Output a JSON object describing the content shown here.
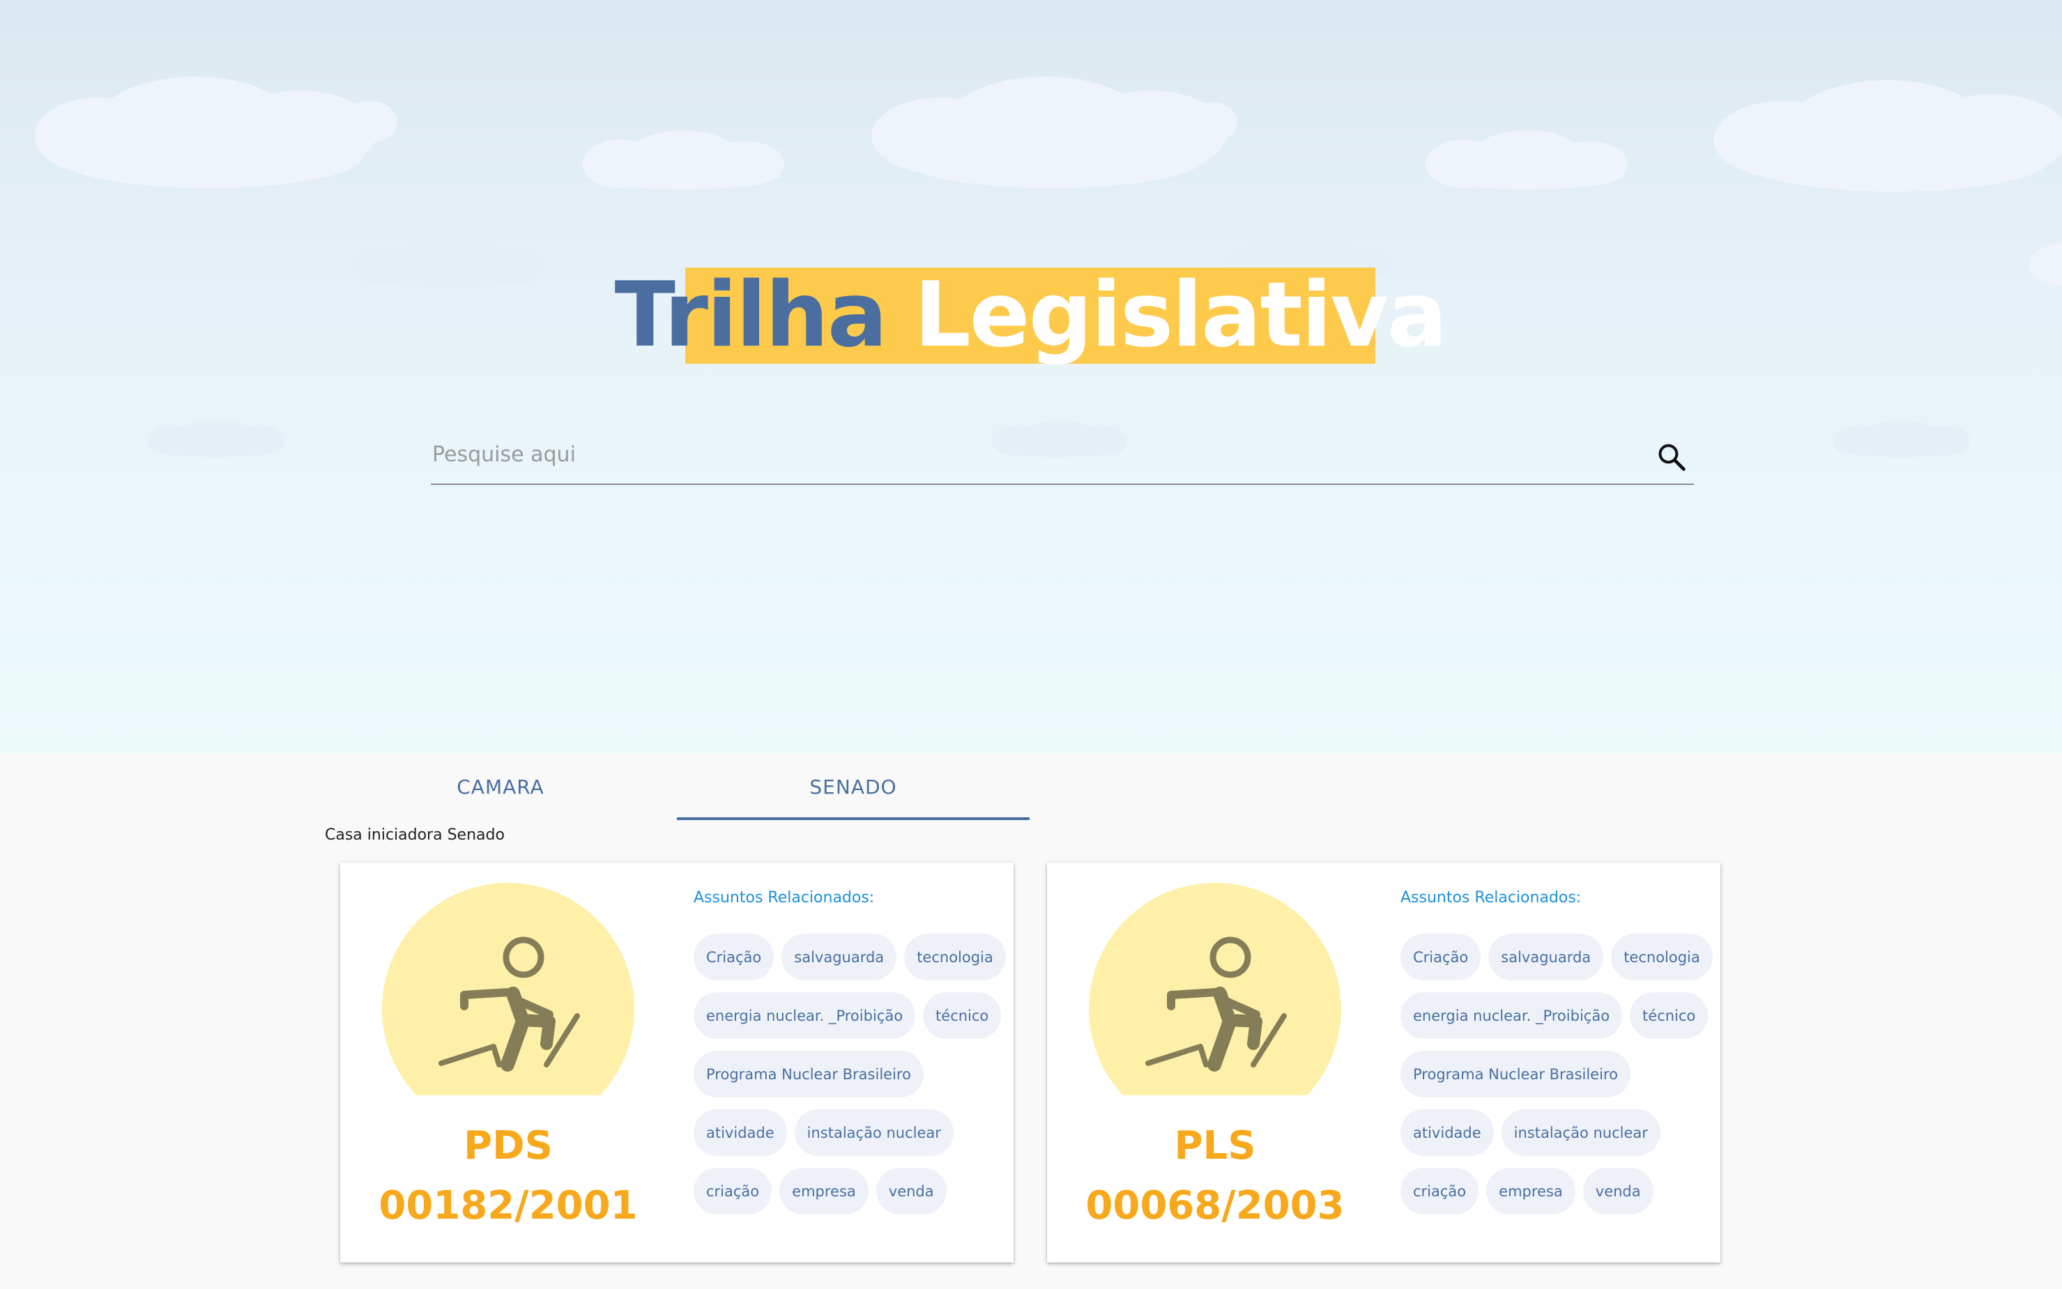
{
  "header": {
    "title_part1": "Trilha",
    "title_part2": "Legislativa"
  },
  "search": {
    "placeholder": "Pesquise aqui",
    "value": "",
    "icon": "search-icon"
  },
  "tabs": [
    {
      "label": "CAMARA",
      "active": false
    },
    {
      "label": "SENADO",
      "active": true
    }
  ],
  "casa_label": "Casa iniciadora Senado",
  "colors": {
    "accent_blue": "#4a6ea0",
    "title_bg": "#fdca4b",
    "number_orange": "#f7a81b",
    "subject_title_blue": "#1e8fd6",
    "chip_bg": "#eef2f8"
  },
  "cards": [
    {
      "kind": "PDS",
      "number": "00182/2001",
      "subjects_title": "Assuntos Relacionados:",
      "icon": "climbing-person-icon",
      "chip_rows": [
        [
          "Criação",
          "salvaguarda",
          "tecnologia"
        ],
        [
          "energia nuclear. _Proibição",
          "técnico"
        ],
        [
          "Programa Nuclear Brasileiro"
        ],
        [
          "atividade",
          "instalação nuclear"
        ],
        [
          "criação",
          "empresa",
          "venda"
        ]
      ]
    },
    {
      "kind": "PLS",
      "number": "00068/2003",
      "subjects_title": "Assuntos Relacionados:",
      "icon": "climbing-person-icon",
      "chip_rows": [
        [
          "Criação",
          "salvaguarda",
          "tecnologia"
        ],
        [
          "energia nuclear. _Proibição",
          "técnico"
        ],
        [
          "Programa Nuclear Brasileiro"
        ],
        [
          "atividade",
          "instalação nuclear"
        ],
        [
          "criação",
          "empresa",
          "venda"
        ]
      ]
    }
  ]
}
